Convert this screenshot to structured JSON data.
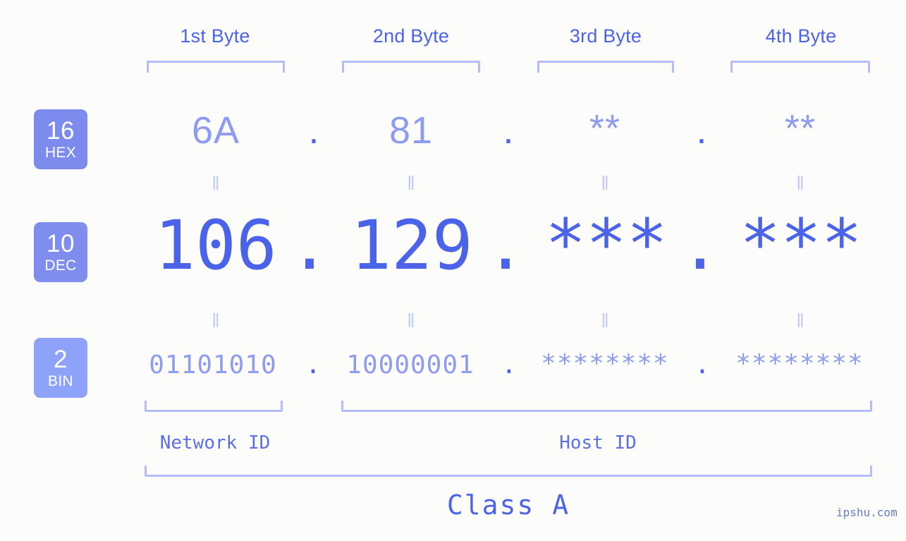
{
  "meta": {
    "background_color": "#fcfdfa",
    "accent_color": "#4b63e8",
    "accent_light_color": "#8d9bf0",
    "bracket_color": "#b3bdf9",
    "watermark": "ipshu.com"
  },
  "columns": [
    {
      "header": "1st Byte"
    },
    {
      "header": "2nd Byte"
    },
    {
      "header": "3rd Byte"
    },
    {
      "header": "4th Byte"
    }
  ],
  "bases": [
    {
      "num": "16",
      "name": "HEX",
      "color": "#7d8bef"
    },
    {
      "num": "10",
      "name": "DEC",
      "color": "#7f8def"
    },
    {
      "num": "2",
      "name": "BIN",
      "color": "#8da2f8"
    }
  ],
  "rows": {
    "hex": {
      "values": [
        "6A",
        "81",
        "**",
        "**"
      ],
      "separator": "."
    },
    "dec": {
      "values": [
        "106",
        "129",
        "***",
        "***"
      ],
      "separator": "."
    },
    "bin": {
      "values": [
        "01101010",
        "10000001",
        "********",
        "********"
      ],
      "separator": "."
    }
  },
  "connector": "‖",
  "segments": {
    "network_id": "Network ID",
    "host_id": "Host ID",
    "class": "Class A"
  }
}
